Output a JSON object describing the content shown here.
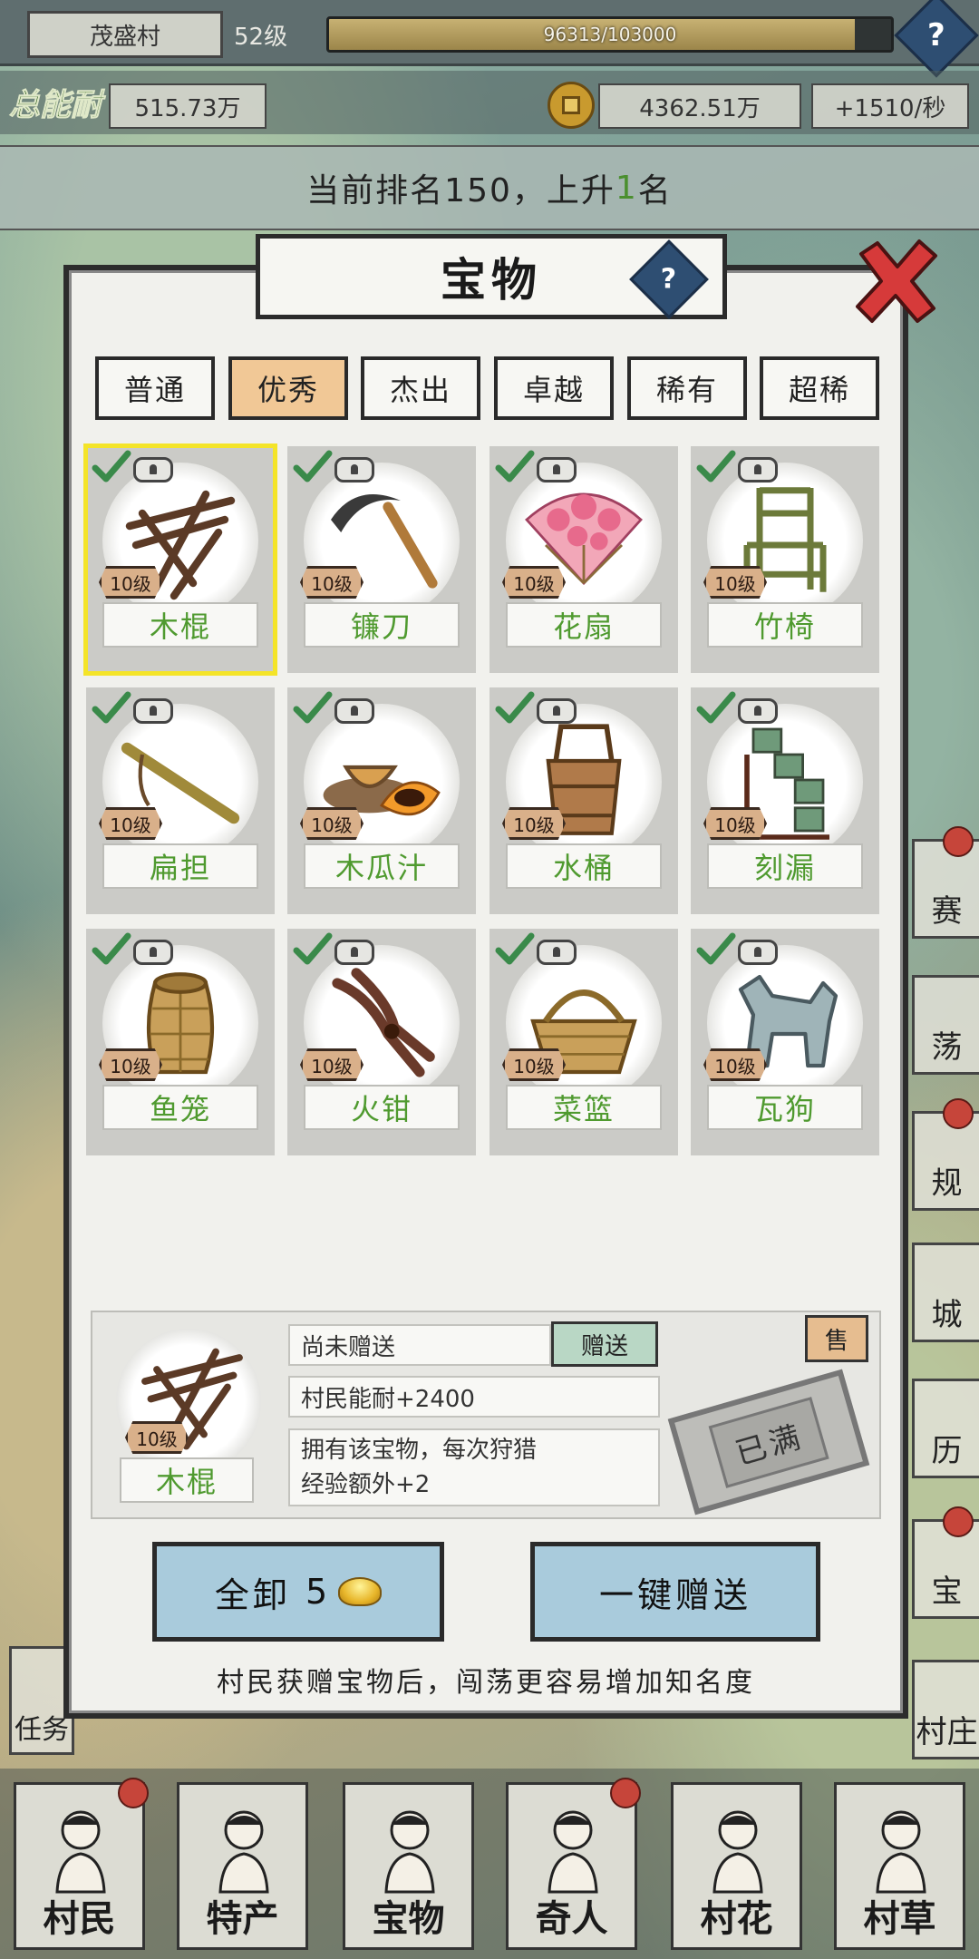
{
  "top": {
    "village_name": "茂盛村",
    "level": "52级",
    "xp_text": "96313/103000",
    "xp_progress": 0.935,
    "help_label": "?"
  },
  "resources": {
    "power_label": "总能耐",
    "power_value": "515.73万",
    "coin_value": "4362.51万",
    "coin_rate": "+1510/秒"
  },
  "rank": {
    "prefix": "当前排名150，上升",
    "up": "1",
    "suffix": "名"
  },
  "side_menu": [
    {
      "label": "赛",
      "badge": true
    },
    {
      "label": "荡",
      "badge": false
    },
    {
      "label": "规",
      "badge": true
    },
    {
      "label": "城",
      "badge": false
    },
    {
      "label": "历",
      "badge": false
    },
    {
      "label": "宝",
      "badge": true
    },
    {
      "label": "村庄",
      "badge": false
    }
  ],
  "task_label": "任务",
  "modal": {
    "title": "宝物",
    "help_label": "?",
    "tabs": [
      "普通",
      "优秀",
      "杰出",
      "卓越",
      "稀有",
      "超稀"
    ],
    "active_tab": 1,
    "items": [
      {
        "name": "木棍",
        "level": "10级",
        "icon": "wooden-stick-icon"
      },
      {
        "name": "镰刀",
        "level": "10级",
        "icon": "sickle-icon"
      },
      {
        "name": "花扇",
        "level": "10级",
        "icon": "flower-fan-icon"
      },
      {
        "name": "竹椅",
        "level": "10级",
        "icon": "bamboo-chair-icon"
      },
      {
        "name": "扁担",
        "level": "10级",
        "icon": "carrying-pole-icon"
      },
      {
        "name": "木瓜汁",
        "level": "10级",
        "icon": "papaya-juice-icon"
      },
      {
        "name": "水桶",
        "level": "10级",
        "icon": "water-bucket-icon"
      },
      {
        "name": "刻漏",
        "level": "10级",
        "icon": "water-clock-icon"
      },
      {
        "name": "鱼笼",
        "level": "10级",
        "icon": "fish-trap-icon"
      },
      {
        "name": "火钳",
        "level": "10级",
        "icon": "fire-tongs-icon"
      },
      {
        "name": "菜篮",
        "level": "10级",
        "icon": "vegetable-basket-icon"
      },
      {
        "name": "瓦狗",
        "level": "10级",
        "icon": "clay-dog-icon"
      }
    ],
    "detail": {
      "name": "木棍",
      "level": "10级",
      "status": "尚未赠送",
      "gift_label": "赠送",
      "sell_label": "售",
      "bonus": "村民能耐+2400",
      "desc_line1": "拥有该宝物，每次狩猎",
      "desc_line2": "经验额外+2",
      "stamp": "已满"
    },
    "buttons": {
      "unload_all": "全卸",
      "unload_cost": "5",
      "gift_all": "一键赠送"
    },
    "hint": "村民获赠宝物后，闯荡更容易增加知名度"
  },
  "nav": [
    {
      "label": "村民",
      "badge": true
    },
    {
      "label": "特产",
      "badge": false
    },
    {
      "label": "宝物",
      "badge": false
    },
    {
      "label": "奇人",
      "badge": true
    },
    {
      "label": "村花",
      "badge": false
    },
    {
      "label": "村草",
      "badge": false
    }
  ],
  "colors": {
    "accent_green": "#4f9a2f",
    "active_tab": "#f1c896",
    "selection": "#f4e428",
    "button_blue": "#a9cbdc",
    "close_red": "#d63a3a"
  }
}
